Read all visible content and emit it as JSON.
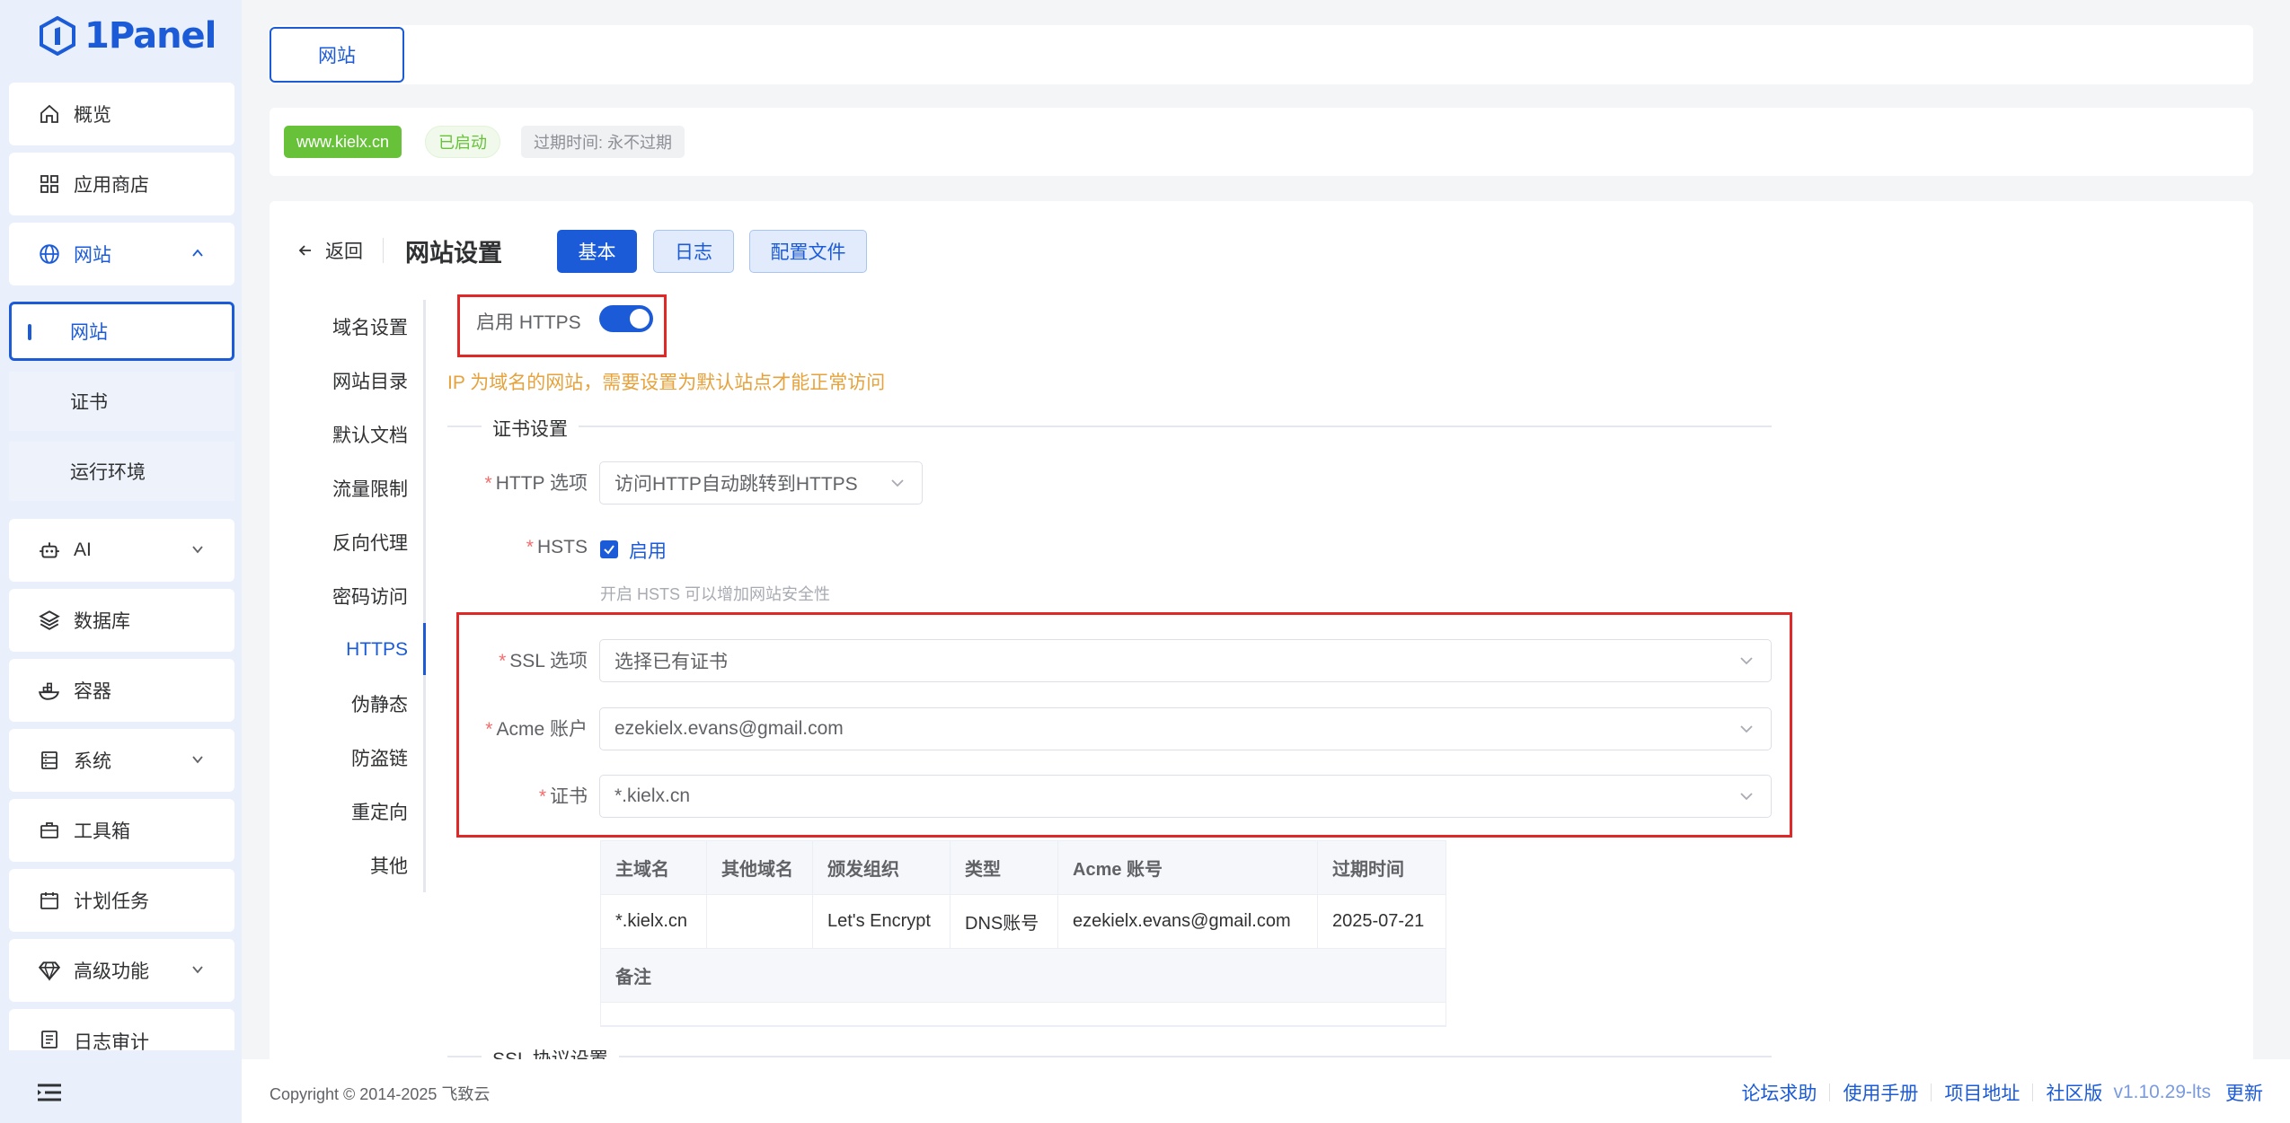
{
  "app": {
    "logo_text": "1Panel"
  },
  "sidebar": {
    "items": [
      {
        "label": "概览",
        "icon": "home-icon"
      },
      {
        "label": "应用商店",
        "icon": "app-store-icon"
      },
      {
        "label": "网站",
        "icon": "globe-icon"
      },
      {
        "label": "AI",
        "icon": "robot-icon"
      },
      {
        "label": "数据库",
        "icon": "layers-icon"
      },
      {
        "label": "容器",
        "icon": "container-icon"
      },
      {
        "label": "系统",
        "icon": "server-icon"
      },
      {
        "label": "工具箱",
        "icon": "toolbox-icon"
      },
      {
        "label": "计划任务",
        "icon": "calendar-icon"
      },
      {
        "label": "高级功能",
        "icon": "diamond-icon"
      },
      {
        "label": "日志审计",
        "icon": "log-icon"
      }
    ],
    "subitems": [
      {
        "label": "网站"
      },
      {
        "label": "证书"
      },
      {
        "label": "运行环境"
      }
    ]
  },
  "topbar": {
    "tab_label": "网站"
  },
  "info": {
    "domain": "www.kielx.cn",
    "status": "已启动",
    "expire": "过期时间: 永不过期"
  },
  "header": {
    "back_label": "返回",
    "title": "网站设置",
    "tabs": [
      "基本",
      "日志",
      "配置文件"
    ]
  },
  "vnav": [
    "域名设置",
    "网站目录",
    "默认文档",
    "流量限制",
    "反向代理",
    "密码访问",
    "HTTPS",
    "伪静态",
    "防盗链",
    "重定向",
    "其他"
  ],
  "https": {
    "enable_label": "启用 HTTPS",
    "enabled": true,
    "warning": "IP 为域名的网站，需要设置为默认站点才能正常访问",
    "cert_section": "证书设置",
    "http_option_label": "HTTP 选项",
    "http_option_value": "访问HTTP自动跳转到HTTPS",
    "hsts_label": "HSTS",
    "hsts_check_label": "启用",
    "hsts_hint": "开启 HSTS 可以增加网站安全性",
    "ssl_option_label": "SSL 选项",
    "ssl_option_value": "选择已有证书",
    "acme_label": "Acme 账户",
    "acme_value": "ezekielx.evans@gmail.com",
    "cert_label": "证书",
    "cert_value": "*.kielx.cn",
    "protocol_section": "SSL 协议设置"
  },
  "cert_table": {
    "headers": [
      "主域名",
      "其他域名",
      "颁发组织",
      "类型",
      "Acme 账号",
      "过期时间"
    ],
    "row": [
      "*.kielx.cn",
      "",
      "Let's Encrypt",
      "DNS账号",
      "ezekielx.evans@gmail.com",
      "2025-07-21"
    ],
    "note_label": "备注"
  },
  "footer": {
    "copyright": "Copyright © 2014-2025 飞致云",
    "links": [
      "论坛求助",
      "使用手册",
      "项目地址",
      "社区版"
    ],
    "version": "v1.10.29-lts",
    "update": "更新"
  },
  "colors": {
    "primary": "#1b5bd8",
    "success": "#67c23a",
    "warning": "#e6a23c",
    "highlight": "#e02828"
  }
}
